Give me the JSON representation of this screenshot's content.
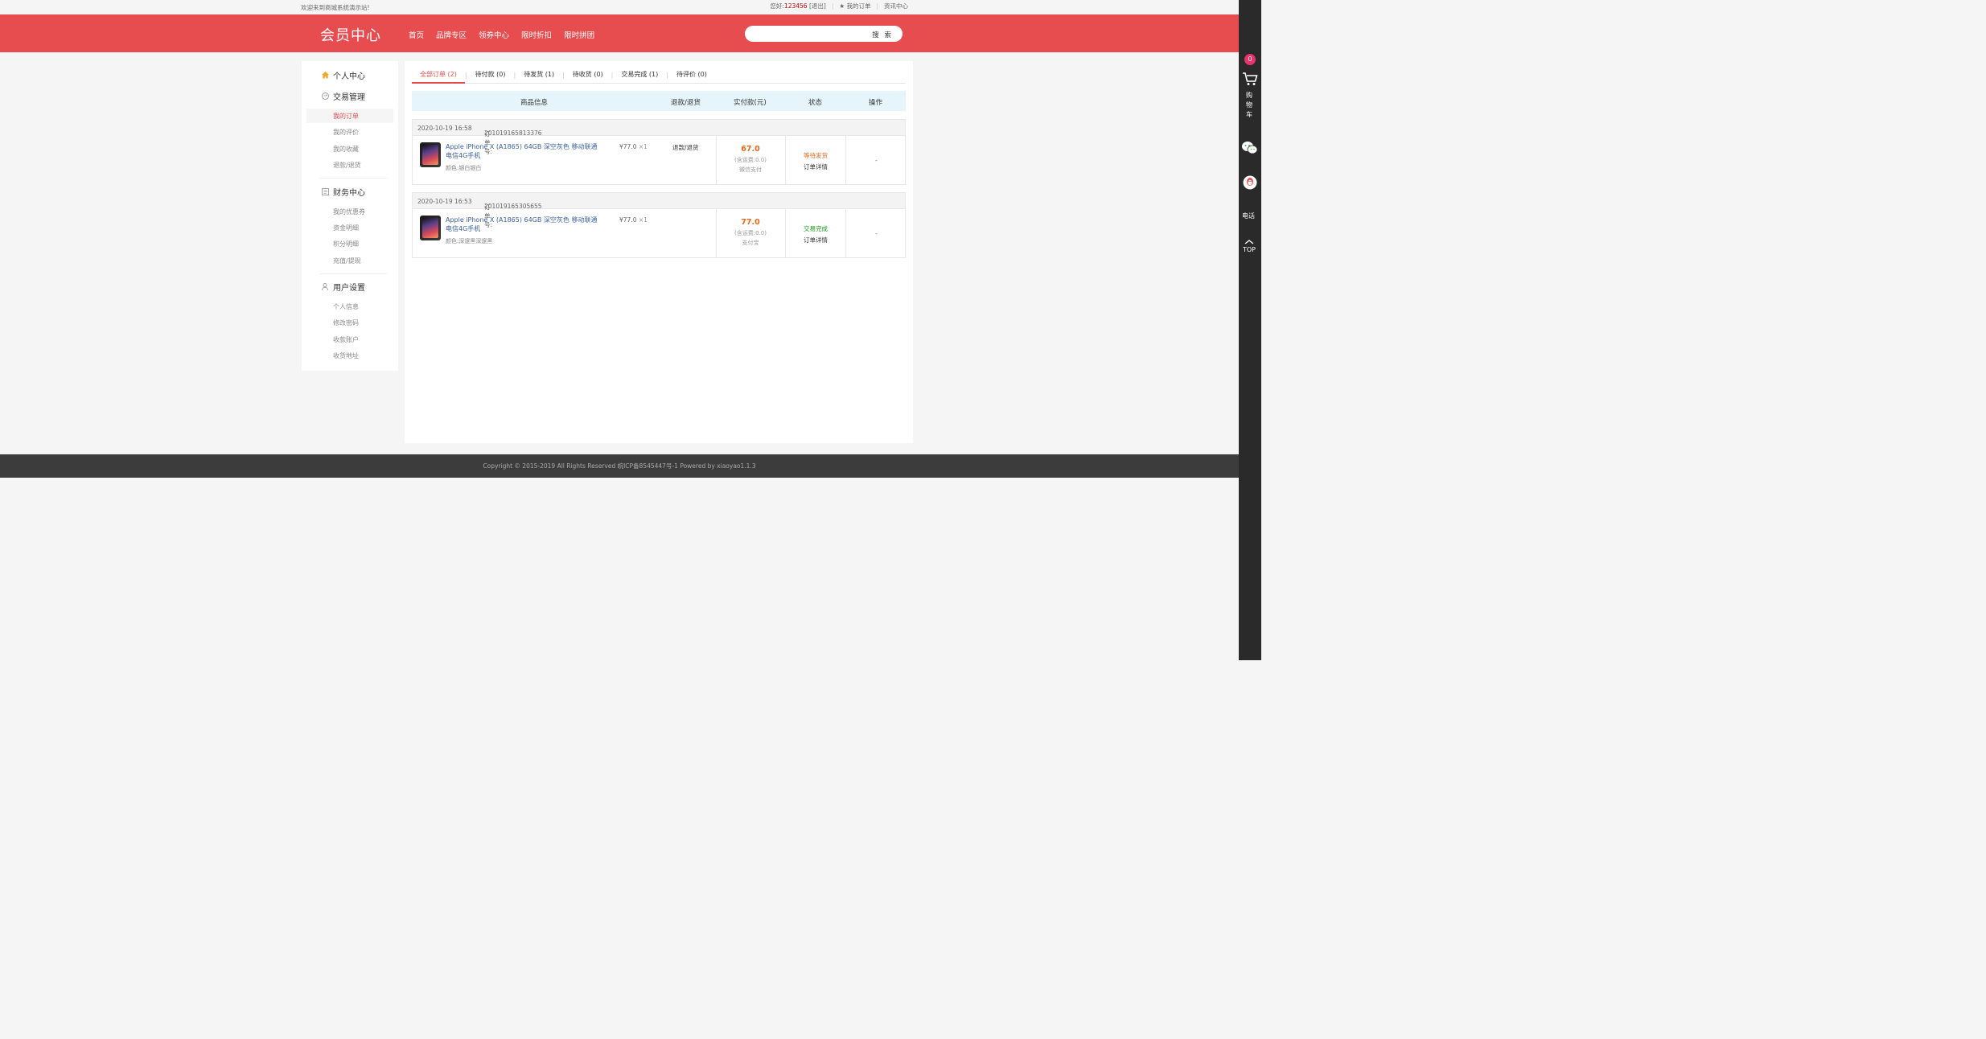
{
  "topbar": {
    "welcome": "欢迎来到商城系统演示站!",
    "greeting": "您好:",
    "username": "123456",
    "logout": "[退出]",
    "my_orders": "我的订单",
    "news": "资讯中心"
  },
  "header": {
    "logo": "会员中心",
    "nav": [
      "首页",
      "品牌专区",
      "领券中心",
      "限时折扣",
      "限时拼团"
    ],
    "search_placeholder": "",
    "search_button": "搜 索"
  },
  "sidebar": {
    "groups": [
      {
        "label": "个人中心",
        "icon": "home-icon"
      },
      {
        "label": "交易管理",
        "icon": "refresh-icon"
      },
      {
        "label": "财务中心",
        "icon": "ledger-icon"
      },
      {
        "label": "用户设置",
        "icon": "user-icon"
      }
    ],
    "trade_items": [
      "我的订单",
      "我的评价",
      "我的收藏",
      "退款/退货"
    ],
    "finance_items": [
      "我的优惠券",
      "资金明细",
      "积分明细",
      "充值/提现"
    ],
    "settings_items": [
      "个人信息",
      "修改密码",
      "收款账户",
      "收货地址"
    ],
    "active_item": "我的订单",
    "accent_color": "#e74c4f"
  },
  "tabs": [
    {
      "label": "全部订单",
      "count": "(2)",
      "active": true
    },
    {
      "label": "待付款",
      "count": "(0)"
    },
    {
      "label": "待发货",
      "count": "(1)"
    },
    {
      "label": "待收货",
      "count": "(0)"
    },
    {
      "label": "交易完成",
      "count": "(1)"
    },
    {
      "label": "待评价",
      "count": "(0)"
    }
  ],
  "table_header": {
    "goods": "商品信息",
    "refund": "退款/退货",
    "paid": "实付款(元)",
    "status": "状态",
    "action": "操作"
  },
  "orders": [
    {
      "date": "2020-10-19 16:58",
      "order_no_label": "订单号:",
      "order_no": "201019165813376",
      "title": "Apple iPhone X (A1865) 64GB 深空灰色 移动联通电信4G手机",
      "spec": "颜色:银白银白",
      "price": "¥77.0",
      "qty": "×1",
      "refund": "退款/退货",
      "amount": "67.0",
      "shipping": "(含运费:0.0)",
      "pay_method": "微信支付",
      "status": "等待发货",
      "status_color": "#e8671c",
      "detail": "订单详情",
      "action": "-"
    },
    {
      "date": "2020-10-19 16:53",
      "order_no_label": "订单号:",
      "order_no": "201019165305655",
      "title": "Apple iPhone X (A1865) 64GB 深空灰色 移动联通电信4G手机",
      "spec": "颜色:深邃黑深邃黑",
      "price": "¥77.0",
      "qty": "×1",
      "refund": "",
      "amount": "77.0",
      "shipping": "(含运费:0.0)",
      "pay_method": "支付宝",
      "status": "交易完成",
      "status_color": "#1a9a1a",
      "detail": "订单详情",
      "action": "-"
    }
  ],
  "footer": {
    "text": "Copyright © 2015-2019 All Rights Reserved 皖ICP备8545447号-1   Powered by xiaoyao1.1.3"
  },
  "right_bar": {
    "cart_count": "0",
    "cart_label": "购物车",
    "phone_label": "电话",
    "top_label": "TOP"
  }
}
